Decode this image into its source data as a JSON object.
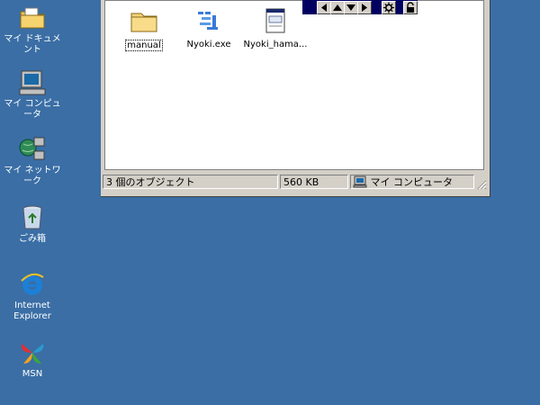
{
  "desktop": {
    "icons": [
      {
        "label": "マイ ドキュメント",
        "icon": "my-documents-folder-icon"
      },
      {
        "label": "マイ コンピュータ",
        "icon": "my-computer-icon"
      },
      {
        "label": "マイ ネットワーク",
        "icon": "my-network-icon"
      },
      {
        "label": "ごみ箱",
        "icon": "recycle-bin-icon"
      },
      {
        "label": "Internet\nExplorer",
        "icon": "internet-explorer-icon"
      },
      {
        "label": "MSN",
        "icon": "msn-butterfly-icon"
      }
    ]
  },
  "window": {
    "files": [
      {
        "label": "manual",
        "icon": "folder-icon",
        "selected": true
      },
      {
        "label": "Nyoki.exe",
        "icon": "exe-icon",
        "selected": false
      },
      {
        "label": "Nyoki_hama...",
        "icon": "document-icon",
        "selected": false
      }
    ],
    "statusbar": {
      "objects": "3 個のオブジェクト",
      "size": "560 KB",
      "zone": "マイ コンピュータ"
    }
  },
  "toolbar": {
    "buttons": [
      "left-arrow-icon",
      "up-arrow-icon",
      "down-arrow-icon",
      "right-arrow-icon",
      "gear-icon",
      "lock-icon"
    ]
  },
  "colors": {
    "desktop": "#3a6ea5",
    "window": "#d4d0c8",
    "strip": "#000060"
  }
}
